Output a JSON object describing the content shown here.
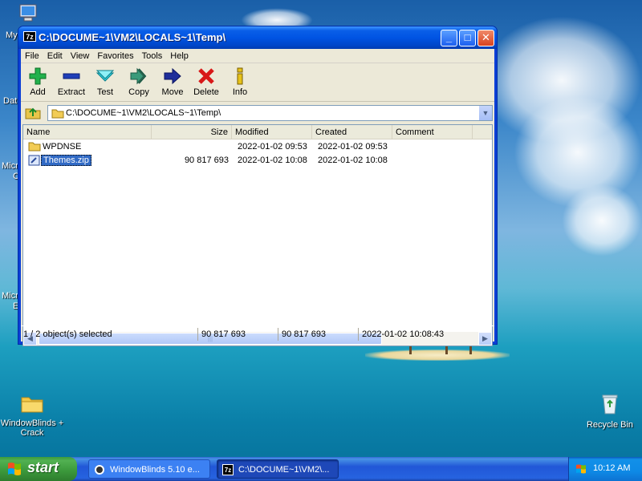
{
  "desktop": {
    "icons": [
      {
        "name": "my-computer",
        "label": "My"
      },
      {
        "name": "dat",
        "label": "Dat"
      },
      {
        "name": "micro1",
        "label": "Micr"
      },
      {
        "name": "micro1b",
        "label": "C"
      },
      {
        "name": "micro2",
        "label": "Micr"
      },
      {
        "name": "micro2b",
        "label": "E"
      },
      {
        "name": "windowblinds",
        "label": "WindowBlinds +\nCrack"
      },
      {
        "name": "recycle-bin",
        "label": "Recycle Bin"
      }
    ]
  },
  "window": {
    "title": "C:\\DOCUME~1\\VM2\\LOCALS~1\\Temp\\",
    "title_icon": "7z",
    "controls": {
      "minimize": "_",
      "maximize": "□",
      "close": "✕"
    },
    "menu": [
      "File",
      "Edit",
      "View",
      "Favorites",
      "Tools",
      "Help"
    ],
    "toolbar": [
      {
        "label": "Add",
        "icon": "plus-icon"
      },
      {
        "label": "Extract",
        "icon": "minus-icon"
      },
      {
        "label": "Test",
        "icon": "check-icon"
      },
      {
        "label": "Copy",
        "icon": "double-arrow-icon"
      },
      {
        "label": "Move",
        "icon": "arrow-right-icon"
      },
      {
        "label": "Delete",
        "icon": "x-icon"
      },
      {
        "label": "Info",
        "icon": "info-icon"
      }
    ],
    "address": "C:\\DOCUME~1\\VM2\\LOCALS~1\\Temp\\",
    "columns": [
      "Name",
      "Size",
      "Modified",
      "Created",
      "Comment"
    ],
    "rows": [
      {
        "name": "WPDNSE",
        "size": "",
        "modified": "2022-01-02 09:53",
        "created": "2022-01-02 09:53",
        "comment": "",
        "type": "folder",
        "selected": false
      },
      {
        "name": "Themes.zip",
        "size": "90 817 693",
        "modified": "2022-01-02 10:08",
        "created": "2022-01-02 10:08",
        "comment": "",
        "type": "archive",
        "selected": true
      }
    ],
    "status": {
      "selection": "1 / 2 object(s) selected",
      "size1": "90 817 693",
      "size2": "90 817 693",
      "timestamp": "2022-01-02 10:08:43"
    }
  },
  "taskbar": {
    "start_label": "start",
    "tasks": [
      {
        "label": "WindowBlinds 5.10 e...",
        "icon": "windowblinds-icon",
        "active": false
      },
      {
        "label": "C:\\DOCUME~1\\VM2\\...",
        "icon": "7z-icon",
        "active": true
      }
    ],
    "clock": "10:12 AM"
  },
  "colors": {
    "titlebar": "#0054e3",
    "selection": "#316ac5",
    "taskbar": "#2157d7",
    "start": "#3c9a3c"
  }
}
